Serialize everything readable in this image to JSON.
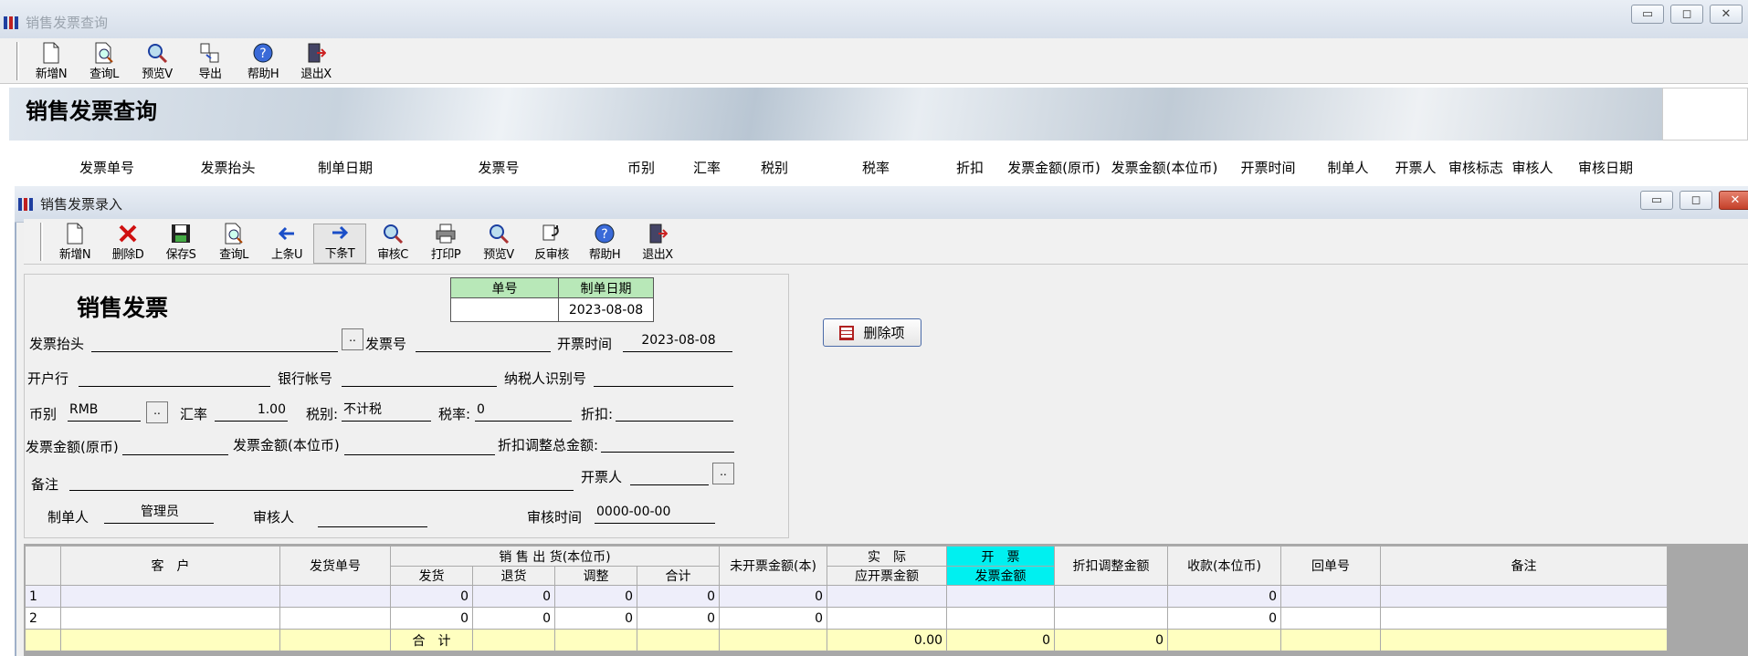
{
  "query_window": {
    "title": "销售发票查询",
    "toolbar": [
      {
        "name": "new",
        "label": "新增N",
        "icon": "new-doc-icon"
      },
      {
        "name": "query",
        "label": "查询L",
        "icon": "query-doc-icon"
      },
      {
        "name": "preview",
        "label": "预览V",
        "icon": "magnifier-icon"
      },
      {
        "name": "export",
        "label": "导出",
        "icon": "export-icon"
      },
      {
        "name": "help",
        "label": "帮助H",
        "icon": "help-icon"
      },
      {
        "name": "exit",
        "label": "退出X",
        "icon": "exit-door-icon"
      }
    ],
    "banner_title": "销售发票查询",
    "columns": [
      "发票单号",
      "发票抬头",
      "制单日期",
      "发票号",
      "币别",
      "汇率",
      "税别",
      "税率",
      "折扣",
      "发票金额(原币)",
      "发票金额(本位币)",
      "开票时间",
      "制单人",
      "开票人",
      "审核标志",
      "审核人",
      "审核日期"
    ]
  },
  "entry_window": {
    "title": "销售发票录入",
    "toolbar": [
      {
        "name": "new",
        "label": "新增N",
        "icon": "new-doc-icon"
      },
      {
        "name": "delete",
        "label": "删除D",
        "icon": "delete-x-icon"
      },
      {
        "name": "save",
        "label": "保存S",
        "icon": "save-disk-icon"
      },
      {
        "name": "query",
        "label": "查询L",
        "icon": "query-doc-icon"
      },
      {
        "name": "prev",
        "label": "上条U",
        "icon": "arrow-left-icon"
      },
      {
        "name": "next",
        "label": "下条T",
        "icon": "arrow-right-icon"
      },
      {
        "name": "audit",
        "label": "审核C",
        "icon": "magnifier-icon"
      },
      {
        "name": "print",
        "label": "打印P",
        "icon": "printer-icon"
      },
      {
        "name": "preview",
        "label": "预览V",
        "icon": "magnifier-icon"
      },
      {
        "name": "unaudit",
        "label": "反审核",
        "icon": "unaudit-icon"
      },
      {
        "name": "help",
        "label": "帮助H",
        "icon": "help-icon"
      },
      {
        "name": "exit",
        "label": "退出X",
        "icon": "exit-door-icon"
      }
    ],
    "form": {
      "heading": "销售发票",
      "doc_no_label": "单号",
      "doc_no": "",
      "date_label": "制单日期",
      "date": "2023-08-08",
      "invoice_header_label": "发票抬头",
      "invoice_header": "",
      "dots": "..",
      "invoice_no_label": "发票号",
      "invoice_no": "",
      "issue_time_label": "开票时间",
      "issue_time": "2023-08-08",
      "bank_label": "开户行",
      "bank": "",
      "account_label": "银行帐号",
      "account": "",
      "taxpayer_label": "纳税人识别号",
      "taxpayer": "",
      "currency_label": "币别",
      "currency": "RMB",
      "rate_label": "汇率",
      "rate": "1.00",
      "tax_type_label": "税别:",
      "tax_type": "不计税",
      "tax_rate_label": "税率:",
      "tax_rate": "0",
      "discount_label": "折扣:",
      "discount": "",
      "amount_orig_label": "发票金额(原币)",
      "amount_orig": "",
      "amount_base_label": "发票金额(本位币)",
      "amount_base": "",
      "discount_adj_label": "折扣调整总金额:",
      "discount_adj": "",
      "remark_label": "备注",
      "remark": "",
      "issuer_label": "开票人",
      "issuer": "",
      "creator_label": "制单人",
      "creator": "管理员",
      "auditor_label": "审核人",
      "auditor": "",
      "audit_time_label": "审核时间",
      "audit_time": "0000-00-00"
    },
    "delete_item_button": "删除项",
    "grid": {
      "h_customer": "客　户",
      "h_ship_no": "发货单号",
      "h_sales_group": "销 售 出 货(本位币)",
      "h_ship": "发货",
      "h_return": "退货",
      "h_adjust": "调整",
      "h_total": "合计",
      "h_uninvoiced": "未开票金额(本)",
      "h_actual": "实　际",
      "h_due_invoice": "应开票金额",
      "h_invoice": "开　票",
      "h_invoice_amount": "发票金额",
      "h_discount_adj": "折扣调整金额",
      "h_receipt": "收款(本位币)",
      "h_return_no": "回单号",
      "h_remark": "备注",
      "rows": [
        {
          "idx": "1",
          "customer": "",
          "ship_no": "",
          "ship": "0",
          "ret": "0",
          "adj": "0",
          "total": "0",
          "uninv": "0",
          "due": "",
          "inv": "",
          "disc": "",
          "receipt": "0",
          "retno": "",
          "remark": ""
        },
        {
          "idx": "2",
          "customer": "",
          "ship_no": "",
          "ship": "0",
          "ret": "0",
          "adj": "0",
          "total": "0",
          "uninv": "0",
          "due": "",
          "inv": "",
          "disc": "",
          "receipt": "0",
          "retno": "",
          "remark": ""
        }
      ],
      "sum_label": "合　计",
      "sum_due": "0.00",
      "sum_invoice": "0",
      "sum_discount": "0"
    }
  },
  "colors": {
    "highlight_cyan": "#00f0f0",
    "sum_row": "#ffffc0",
    "row_odd": "#eeeefa"
  }
}
